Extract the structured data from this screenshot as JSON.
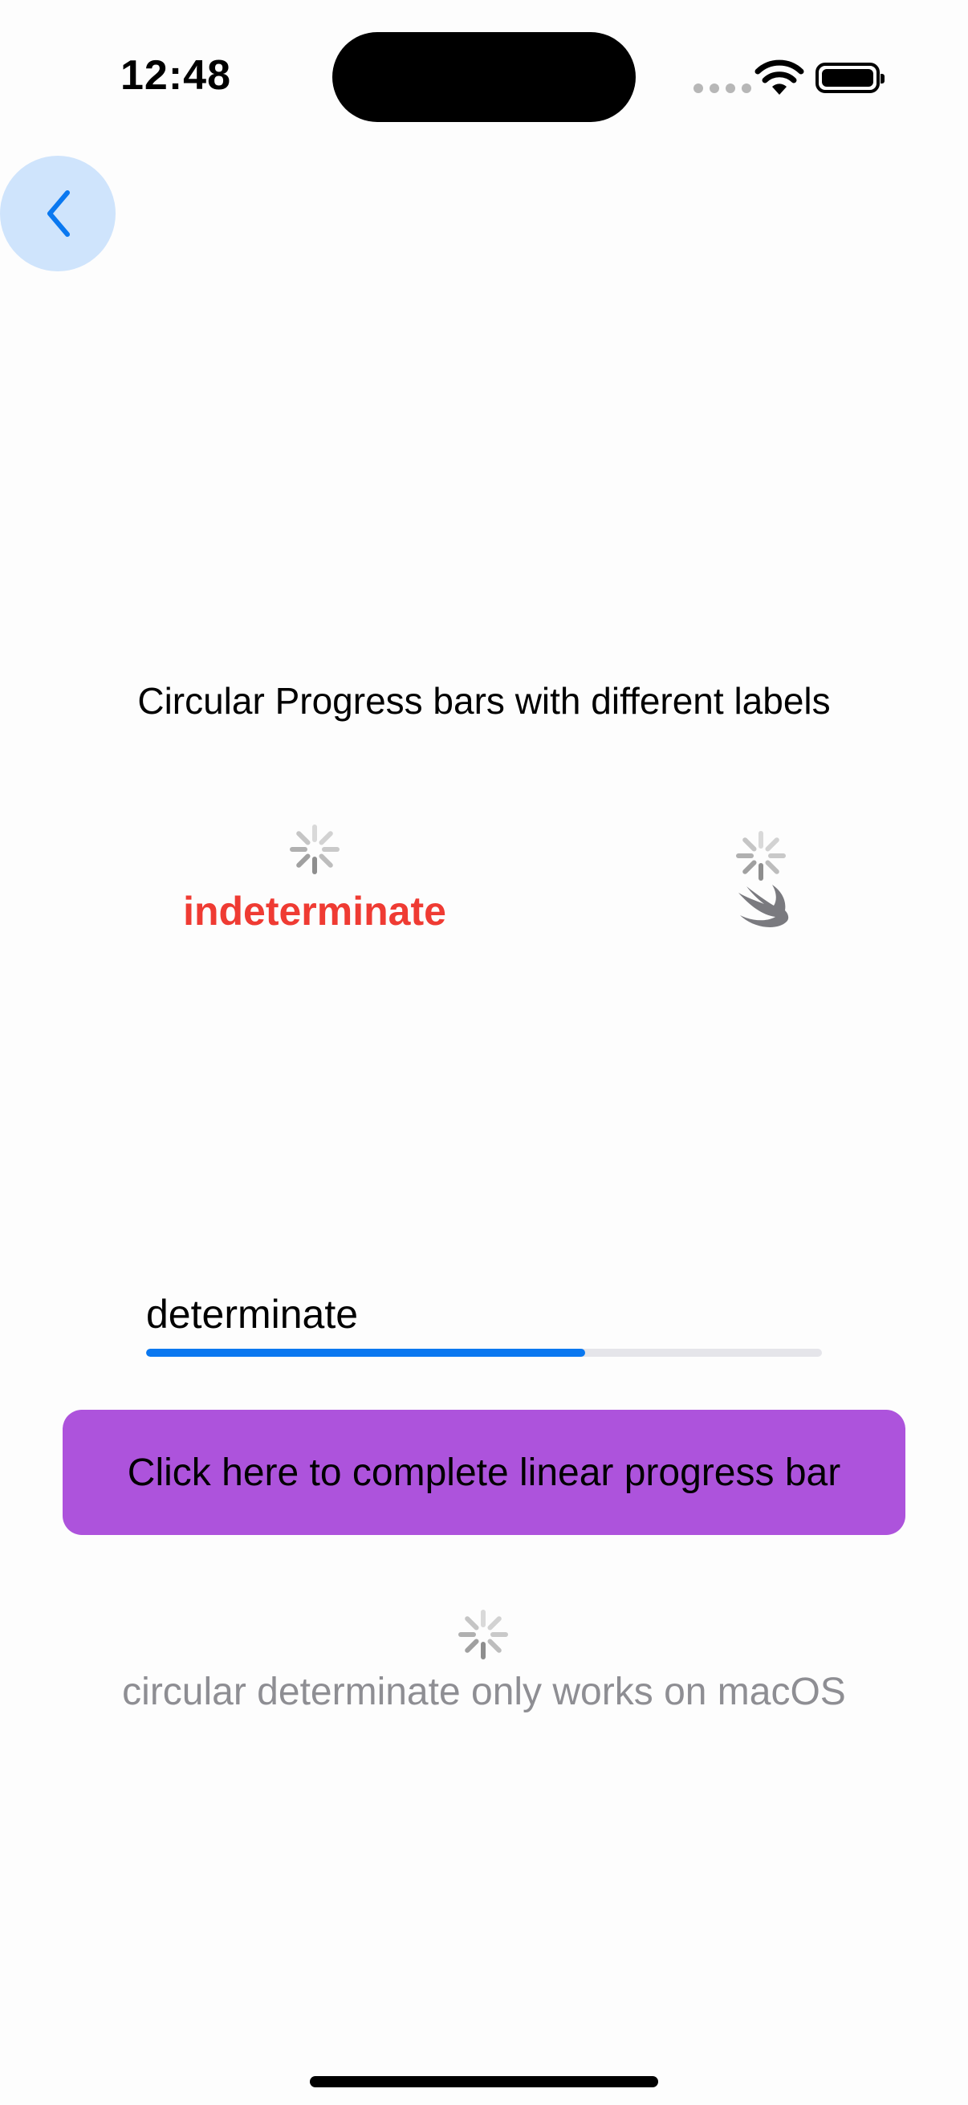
{
  "status_bar": {
    "time": "12:48"
  },
  "nav": {
    "back_icon": "chevron-left-icon"
  },
  "content": {
    "title": "Circular Progress bars with different labels",
    "spinner_1_label": "indeterminate",
    "spinner_2_label_icon": "swift-bird-icon",
    "linear": {
      "label": "determinate",
      "progress": 0.65
    },
    "complete_button_label": "Click here to complete linear progress bar",
    "circular_determinate_label": "circular determinate only works on macOS"
  },
  "colors": {
    "accent": "#0a78f0",
    "indeterminate_label": "#ef3b33",
    "button_background": "#ad53dc",
    "secondary_text": "#8e8e93",
    "back_button_background": "#cfe4fc"
  }
}
